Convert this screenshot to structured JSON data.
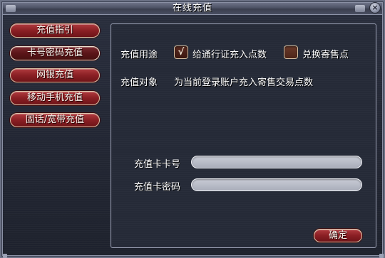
{
  "window": {
    "title": "在线充值",
    "close_glyph": "×"
  },
  "sidebar": {
    "items": [
      {
        "label": "充值指引",
        "active": false
      },
      {
        "label": "卡号密码充值",
        "active": true
      },
      {
        "label": "网银充值",
        "active": false
      },
      {
        "label": "移动手机充值",
        "active": false
      },
      {
        "label": "固话/宽带充值",
        "active": false
      }
    ]
  },
  "form": {
    "purpose_label": "充值用途",
    "option_tongxing": {
      "label": "给通行证充入点数",
      "checked": true,
      "check_glyph": "√"
    },
    "option_jishou": {
      "label": "兑换寄售点",
      "checked": false
    },
    "target_label": "充值对象",
    "target_value": "为当前登录账户充入寄售交易点数",
    "card_number_label": "充值卡卡号",
    "card_number_value": "",
    "card_password_label": "充值卡密码",
    "card_password_value": "",
    "confirm_label": "确定"
  },
  "colors": {
    "button_red": "#8a1f24",
    "panel_bg": "#252a37",
    "text": "#ffffff"
  }
}
